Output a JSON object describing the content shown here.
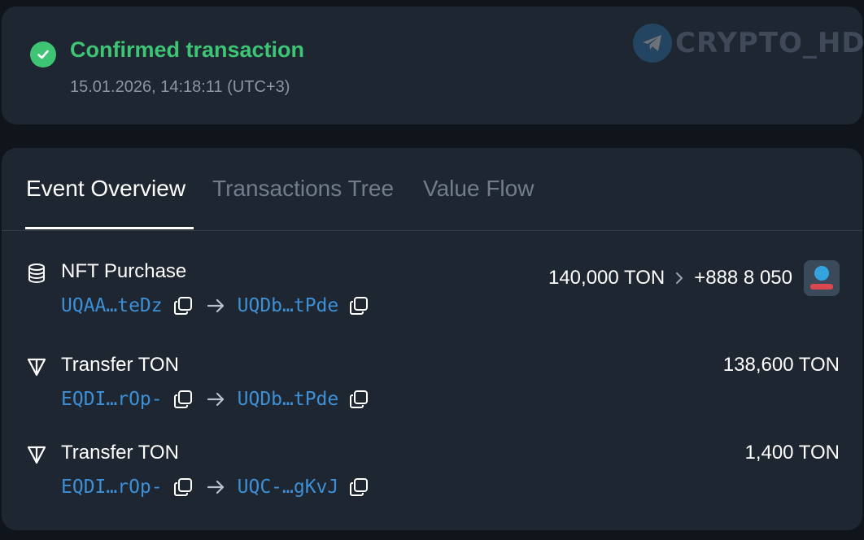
{
  "status": {
    "title": "Confirmed transaction",
    "timestamp": "15.01.2026, 14:18:11 (UTC+3)",
    "icon": "check-circle-icon",
    "color": "#3dc574"
  },
  "watermark": {
    "text": "CRYPTO_HD",
    "icon": "telegram-icon"
  },
  "tabs": [
    {
      "label": "Event Overview",
      "active": true
    },
    {
      "label": "Transactions Tree",
      "active": false
    },
    {
      "label": "Value Flow",
      "active": false
    }
  ],
  "events": [
    {
      "icon": "database-icon",
      "title": "NFT Purchase",
      "from": "UQAA…teDz",
      "to": "UQDb…tPde",
      "amount": "140,000 TON",
      "nft_name": "+888 8 050"
    },
    {
      "icon": "ton-icon",
      "title": "Transfer TON",
      "from": "EQDI…rOp-",
      "to": "UQDb…tPde",
      "amount": "138,600 TON"
    },
    {
      "icon": "ton-icon",
      "title": "Transfer TON",
      "from": "EQDI…rOp-",
      "to": "UQC-…gKvJ",
      "amount": "1,400 TON"
    }
  ],
  "colors": {
    "accent_green": "#3dc574",
    "address_blue": "#3d8fd6",
    "card_bg": "#1e2632",
    "page_bg": "#10151c"
  }
}
